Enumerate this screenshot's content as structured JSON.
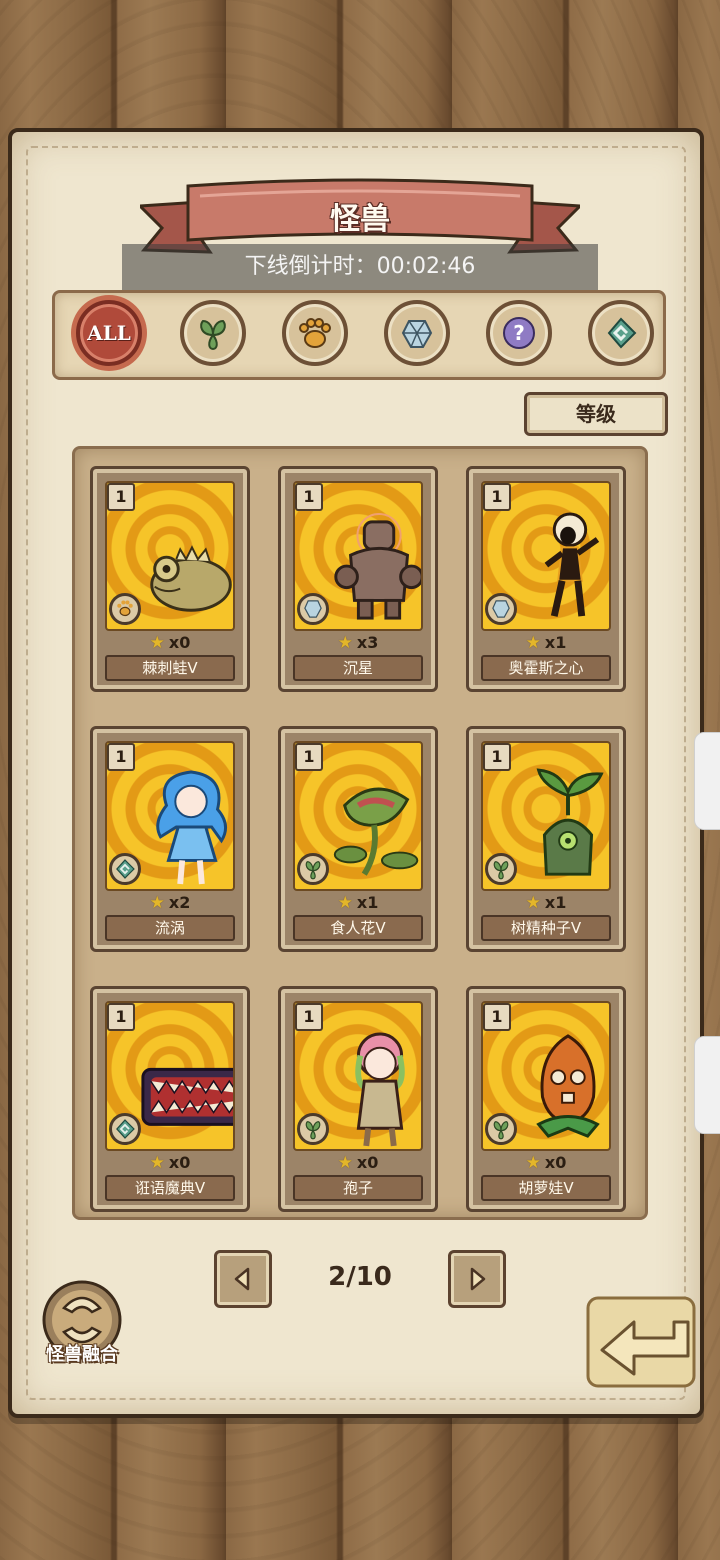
{
  "header": {
    "title": "怪兽",
    "countdown": "下线倒计时：00:02:46"
  },
  "filters": [
    {
      "label": "ALL",
      "icon": "all-filter-icon",
      "active": true
    },
    {
      "label": "",
      "icon": "leaf-icon",
      "active": false
    },
    {
      "label": "",
      "icon": "paw-icon",
      "active": false
    },
    {
      "label": "",
      "icon": "crystal-icon",
      "active": false
    },
    {
      "label": "",
      "icon": "question-icon",
      "active": false
    },
    {
      "label": "",
      "icon": "spiral-icon",
      "active": false
    }
  ],
  "sort": {
    "label": "等级"
  },
  "cards": [
    {
      "level": "1",
      "count": "x0",
      "name": "棘刺蛙Ⅴ",
      "type_icon": "paw-icon",
      "monster": "spiky-frog"
    },
    {
      "level": "1",
      "count": "x3",
      "name": "沉星",
      "type_icon": "crystal-icon",
      "monster": "rock-golem"
    },
    {
      "level": "1",
      "count": "x1",
      "name": "奥霍斯之心",
      "type_icon": "crystal-icon",
      "monster": "lava-girl"
    },
    {
      "level": "1",
      "count": "x2",
      "name": "流涡",
      "type_icon": "spiral-icon",
      "monster": "water-girl"
    },
    {
      "level": "1",
      "count": "x1",
      "name": "食人花Ⅴ",
      "type_icon": "leaf-icon",
      "monster": "flytrap"
    },
    {
      "level": "1",
      "count": "x1",
      "name": "树精种子Ⅴ",
      "type_icon": "leaf-icon",
      "monster": "sprout"
    },
    {
      "level": "1",
      "count": "x0",
      "name": "诳语魔典Ⅴ",
      "type_icon": "spiral-icon",
      "monster": "mimic-book"
    },
    {
      "level": "1",
      "count": "x0",
      "name": "孢子",
      "type_icon": "leaf-icon",
      "monster": "spore-girl"
    },
    {
      "level": "1",
      "count": "x0",
      "name": "胡萝娃Ⅴ",
      "type_icon": "leaf-icon",
      "monster": "carrot"
    }
  ],
  "pagination": {
    "label": "2/10",
    "current": 2,
    "total": 10
  },
  "fusion": {
    "label": "怪兽融合"
  },
  "colors": {
    "accent": "#b04a3a",
    "parchment": "#efe6cf",
    "card_art": "#f6c429",
    "wood": "#8a6844"
  }
}
